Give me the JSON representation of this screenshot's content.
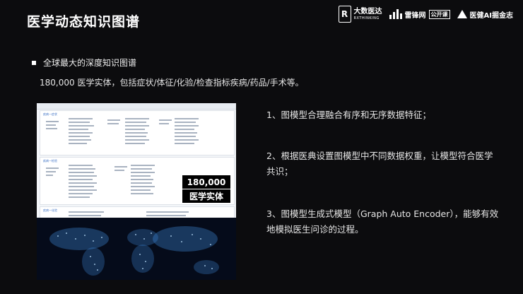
{
  "slide": {
    "title": "医学动态知识图谱",
    "bullet": "全球最大的深度知识图谱",
    "subline": "180,000 医学实体，包括症状/体征/化验/检查指标疾病/药品/手术等。",
    "points": [
      "1、图模型合理融合有序和无序数据特征；",
      "2、根据医典设置图模型中不同数据权重，让模型符合医学共识；",
      "3、图模型生成式模型（Graph Auto Encoder），能够有效地模拟医生问诊的过程。"
    ]
  },
  "logos": {
    "logo1_main": "大数医达",
    "logo1_sub": "RXTHINKING",
    "logo2": "雷锋网",
    "logo2_tag": "公开课",
    "logo3": "医健AI掘金志"
  },
  "screenshot": {
    "badge_number": "180,000",
    "badge_label": "医学实体",
    "panels": [
      {
        "title": "疾病—症状"
      },
      {
        "title": "疾病—检验"
      },
      {
        "title": "疾病—化验"
      }
    ]
  },
  "colors": {
    "background": "#0c0c0e",
    "text": "#e6e6e6",
    "map_dots": "#4aa3ff"
  }
}
